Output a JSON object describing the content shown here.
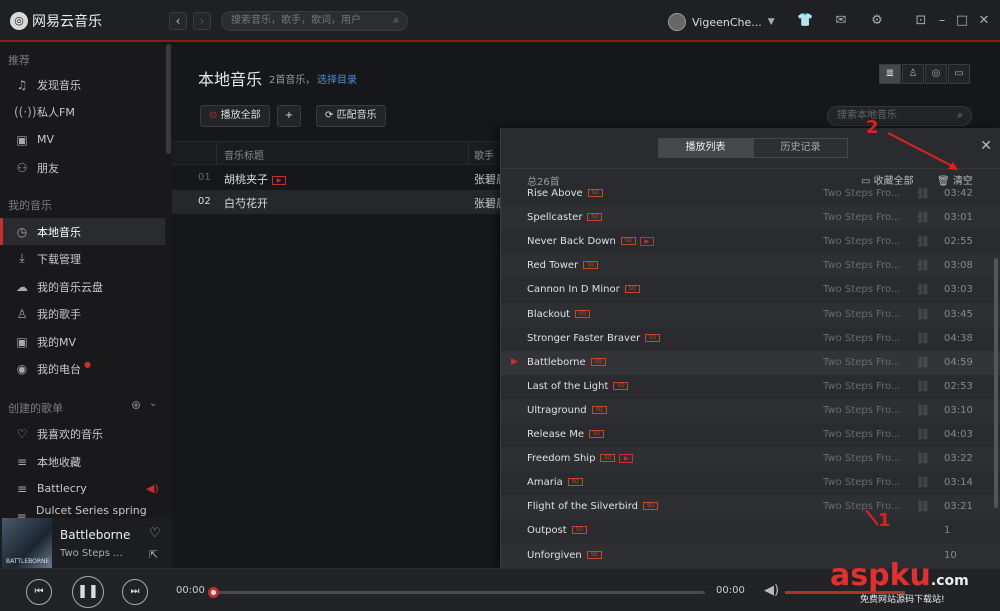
{
  "app": {
    "name": "网易云音乐",
    "search_placeholder": "搜索音乐，歌手，歌词，用户",
    "user": "VigeenChe..."
  },
  "sidebar": {
    "sections": [
      "推荐",
      "我的音乐",
      "创建的歌单"
    ],
    "items": [
      {
        "label": "发现音乐",
        "icon": "music-note-icon"
      },
      {
        "label": "私人FM",
        "icon": "radio-icon"
      },
      {
        "label": "MV",
        "icon": "video-icon"
      },
      {
        "label": "朋友",
        "icon": "friends-icon"
      },
      {
        "label": "本地音乐",
        "icon": "clock-disc-icon"
      },
      {
        "label": "下载管理",
        "icon": "download-icon"
      },
      {
        "label": "我的音乐云盘",
        "icon": "cloud-icon"
      },
      {
        "label": "我的歌手",
        "icon": "person-icon"
      },
      {
        "label": "我的MV",
        "icon": "video-icon"
      },
      {
        "label": "我的电台",
        "icon": "podcast-icon"
      },
      {
        "label": "我喜欢的音乐",
        "icon": "heart-icon"
      },
      {
        "label": "本地收藏",
        "icon": "playlist-icon"
      },
      {
        "label": "Battlecry",
        "icon": "playlist-icon"
      },
      {
        "label": "Dulcet Series spring sp...",
        "icon": "playlist-icon"
      }
    ]
  },
  "now_playing": {
    "title": "Battleborne",
    "artist": "Two Steps ...",
    "cover_text": "BATTLEBORNE"
  },
  "main": {
    "title": "本地音乐",
    "count": "2首音乐，",
    "choose_dir": "选择目录",
    "play_all": "播放全部",
    "add": "+",
    "match": "匹配音乐",
    "local_search_placeholder": "搜索本地音乐",
    "columns": [
      "音乐标题",
      "歌手"
    ],
    "rows": [
      {
        "num": "01",
        "title": "胡桃夹子",
        "artist": "张碧晨"
      },
      {
        "num": "02",
        "title": "白芍花开",
        "artist": "张碧晨"
      }
    ]
  },
  "panel": {
    "tabs": [
      "播放列表",
      "历史记录"
    ],
    "total": "总26首",
    "collect_all": "收藏全部",
    "clear": "清空",
    "songs": [
      {
        "name": "Rise Above",
        "album": "Two Steps Fro...",
        "dur": "03:42",
        "mv": false
      },
      {
        "name": "Spellcaster",
        "album": "Two Steps Fro...",
        "dur": "03:01",
        "mv": false
      },
      {
        "name": "Never Back Down",
        "album": "Two Steps Fro...",
        "dur": "02:55",
        "mv": true
      },
      {
        "name": "Red Tower",
        "album": "Two Steps Fro...",
        "dur": "03:08",
        "mv": false
      },
      {
        "name": "Cannon In D Minor",
        "album": "Two Steps Fro...",
        "dur": "03:03",
        "mv": false
      },
      {
        "name": "Blackout",
        "album": "Two Steps Fro...",
        "dur": "03:45",
        "mv": false
      },
      {
        "name": "Stronger Faster Braver",
        "album": "Two Steps Fro...",
        "dur": "04:38",
        "mv": false
      },
      {
        "name": "Battleborne",
        "album": "Two Steps Fro...",
        "dur": "04:59",
        "mv": false,
        "playing": true
      },
      {
        "name": "Last of the Light",
        "album": "Two Steps Fro...",
        "dur": "02:53",
        "mv": false
      },
      {
        "name": "Ultraground",
        "album": "Two Steps Fro...",
        "dur": "03:10",
        "mv": false
      },
      {
        "name": "Release Me",
        "album": "Two Steps Fro...",
        "dur": "04:03",
        "mv": false
      },
      {
        "name": "Freedom Ship",
        "album": "Two Steps Fro...",
        "dur": "03:22",
        "mv": true
      },
      {
        "name": "Amaria",
        "album": "Two Steps Fro...",
        "dur": "03:14",
        "mv": false
      },
      {
        "name": "Flight of the Silverbird",
        "album": "Two Steps Fro...",
        "dur": "03:21",
        "mv": false
      },
      {
        "name": "Outpost",
        "album": "",
        "dur": "1",
        "mv": false
      },
      {
        "name": "Unforgiven",
        "album": "",
        "dur": "10",
        "mv": false
      }
    ]
  },
  "player": {
    "current": "00:00",
    "total": "00:00"
  },
  "annotations": {
    "one": "1",
    "two": "2"
  },
  "watermark": {
    "text": "aspku",
    "suffix": ".com",
    "sub": "免费网站源码下载站!"
  },
  "colors": {
    "accent": "#c62f2f",
    "annotation": "#e02020"
  }
}
